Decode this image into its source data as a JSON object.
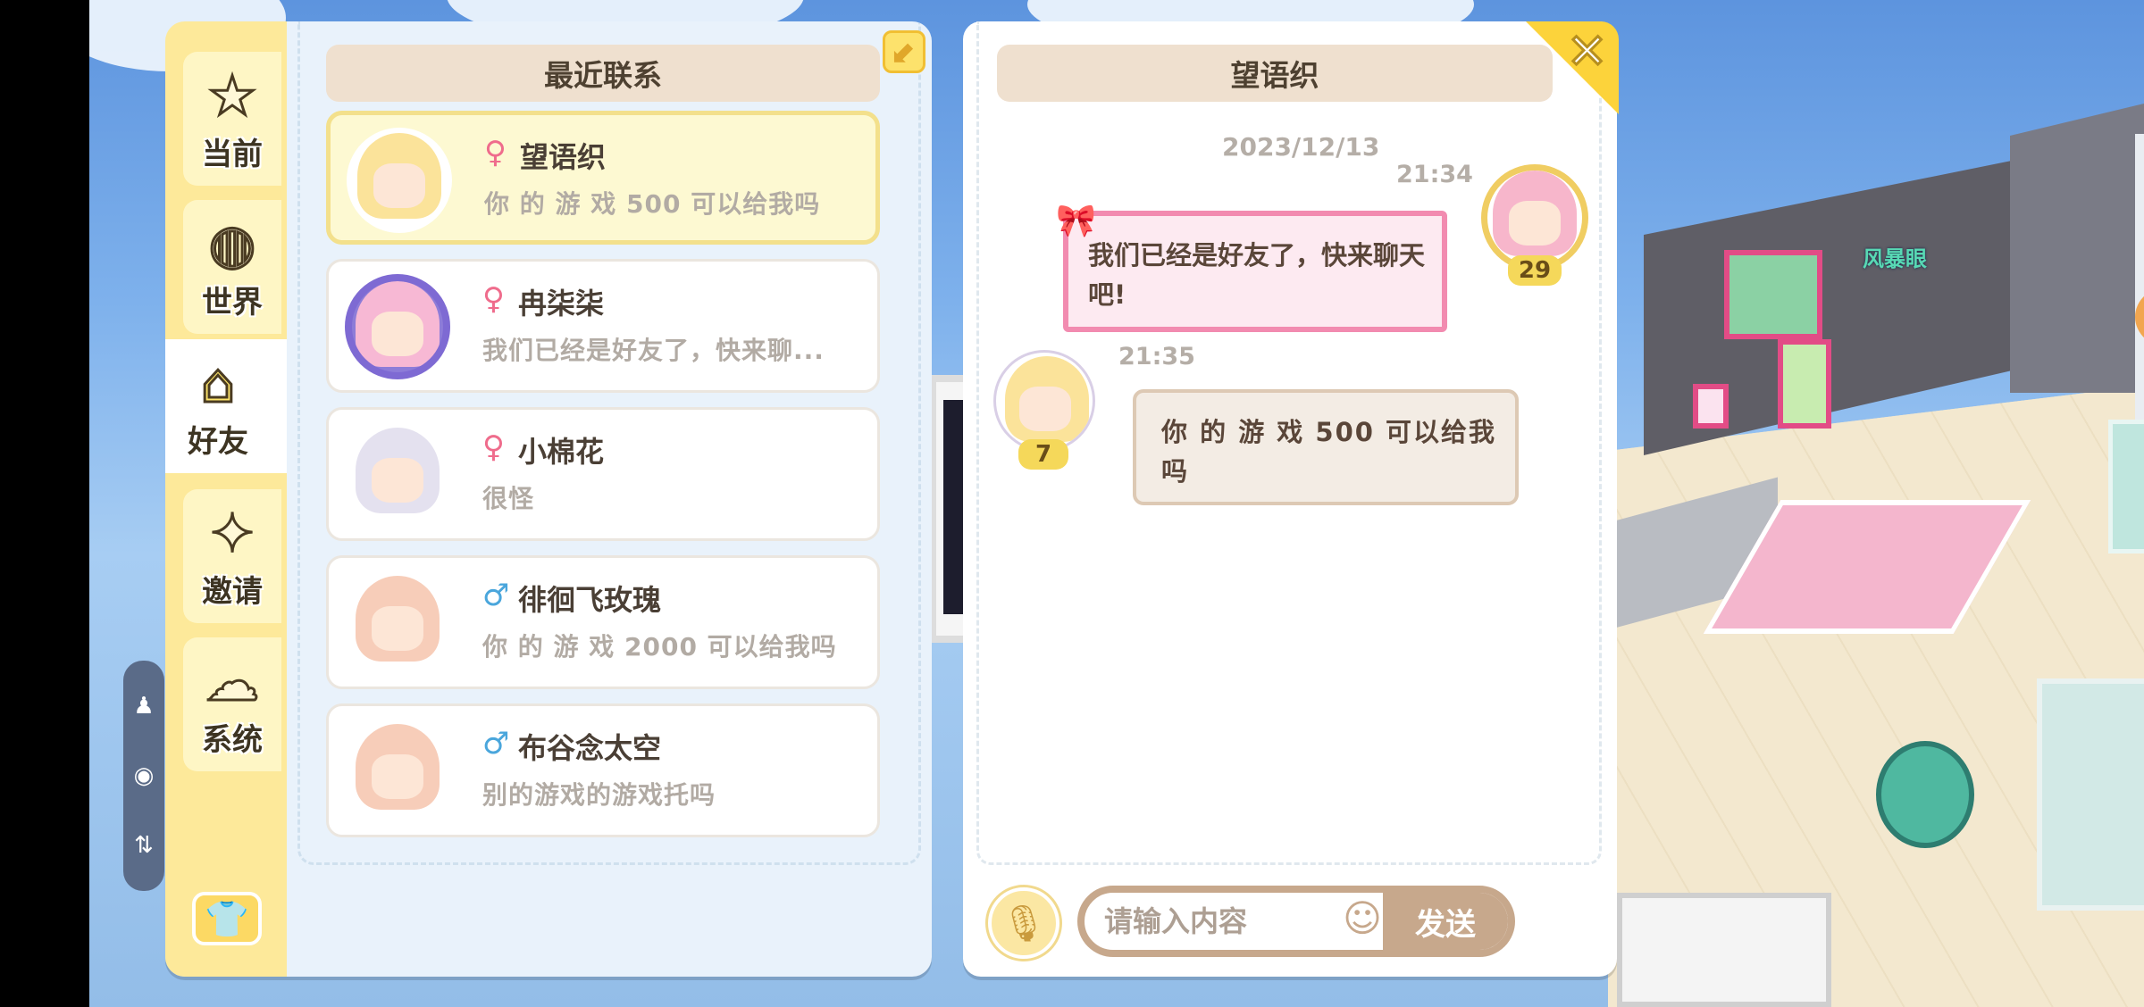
{
  "sidebar": {
    "tabs": [
      {
        "label": "当前",
        "icon": "star-icon"
      },
      {
        "label": "世界",
        "icon": "planet-icon"
      },
      {
        "label": "好友",
        "icon": "house-icon",
        "active": true
      },
      {
        "label": "邀请",
        "icon": "sparkle-stars-icon"
      },
      {
        "label": "系统",
        "icon": "chat-bubble-icon"
      }
    ],
    "bottom_icon": "shirt-icon"
  },
  "recent": {
    "title": "最近联系",
    "contacts": [
      {
        "gender": "♀",
        "name": "望语织",
        "message": "你 的 游 戏 500 可以给我吗",
        "selected": true
      },
      {
        "gender": "♀",
        "name": "冉柒柒",
        "message": "我们已经是好友了，快来聊..."
      },
      {
        "gender": "♀",
        "name": "小棉花",
        "message": "很怪"
      },
      {
        "gender": "♂",
        "name": "徘徊飞玫瑰",
        "message": "你 的 游 戏 2000 可以给我吗"
      },
      {
        "gender": "♂",
        "name": "布谷念太空",
        "message": "别的游戏的游戏托吗"
      }
    ]
  },
  "chat": {
    "title": "望语织",
    "date": "2023/12/13",
    "messages": [
      {
        "time": "21:34",
        "text": "我们已经是好友了，快来聊天吧!",
        "level": "29",
        "side": "right"
      },
      {
        "time": "21:35",
        "text": "你 的 游 戏 500 可以给我吗",
        "level": "7",
        "side": "left"
      }
    ],
    "input_placeholder": "请输入内容",
    "send_label": "发送"
  },
  "scene": {
    "player_name": "风暴眼"
  },
  "colors": {
    "panel_yellow": "#fde99a",
    "header_tan": "#efe0cf",
    "send_brown": "#c7a88c",
    "pink_bubble": "#f28bb0"
  }
}
